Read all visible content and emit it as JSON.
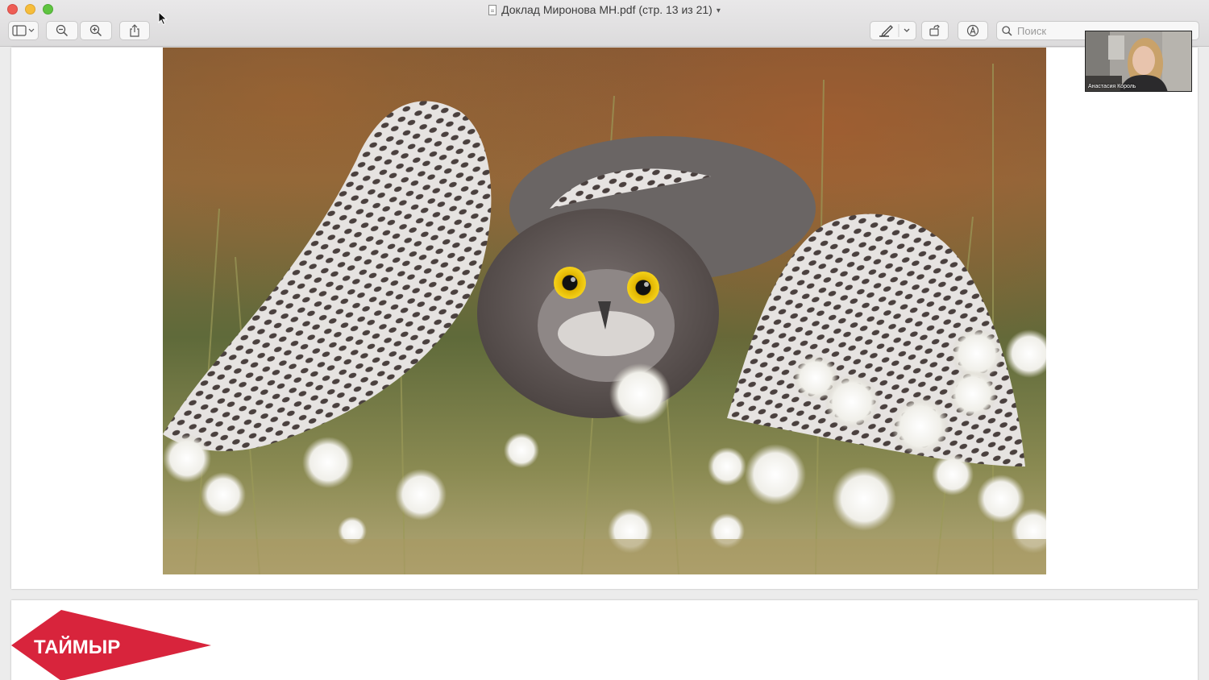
{
  "window": {
    "title": "Доклад Миронова МН.pdf (стр. 13 из 21)"
  },
  "toolbar": {
    "search_placeholder": "Поиск"
  },
  "icons": {
    "sidebar": "sidebar-toggle-icon",
    "zoom_out": "zoom-out-icon",
    "zoom_in": "zoom-in-icon",
    "share": "share-icon",
    "markup": "pen-icon",
    "rotate": "rotate-icon",
    "annotate": "markup-circle-icon",
    "search": "magnifier-icon"
  },
  "colors": {
    "logo_red": "#d8243c",
    "close": "#ee5d55",
    "minimize": "#f6bd3b",
    "maximize": "#5fc440"
  },
  "page14": {
    "logo_text": "ТАЙМЫР"
  },
  "video": {
    "participant_name": "Анастасия Король"
  }
}
